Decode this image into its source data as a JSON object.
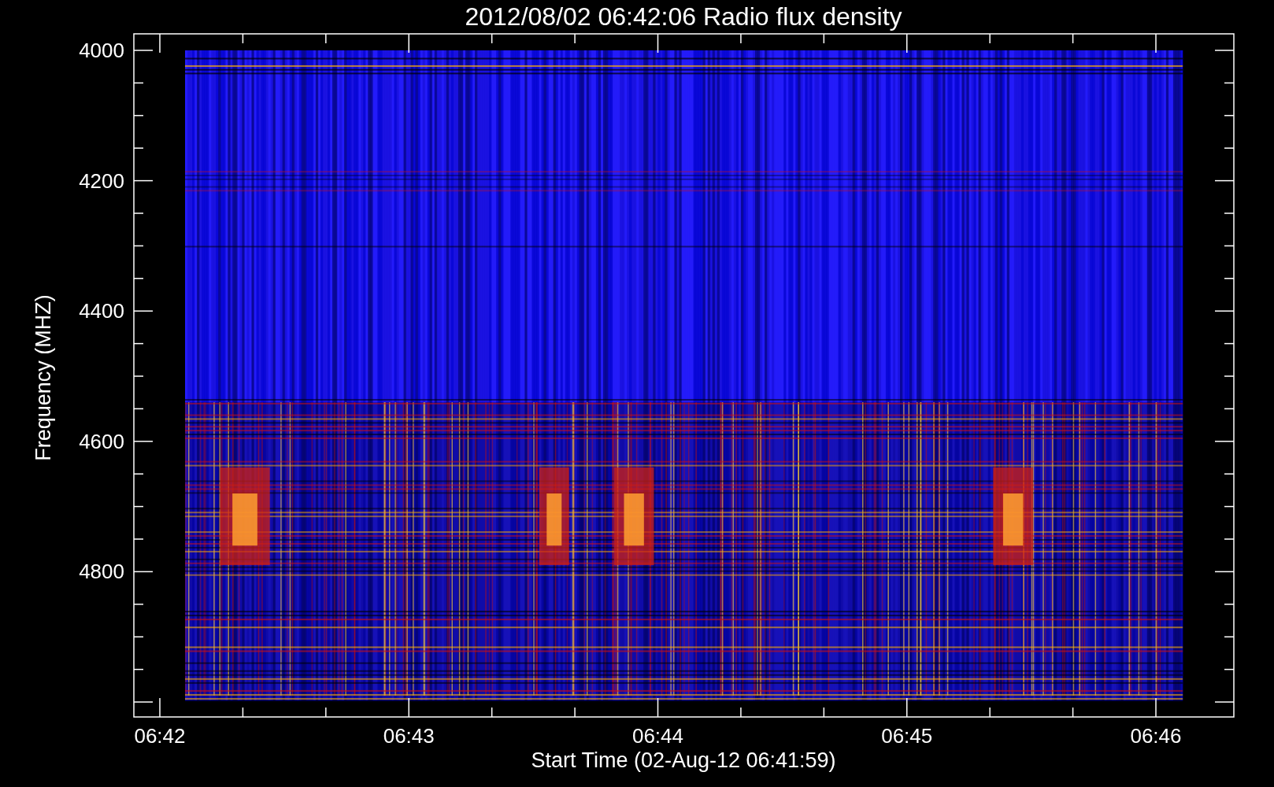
{
  "chart": {
    "title": "2012/08/02 06:42:06 Radio flux density",
    "x_axis": {
      "label": "Start Time (02-Aug-12 06:41:59)",
      "ticks": [
        "06:42",
        "06:43",
        "06:44",
        "06:45",
        "06:46"
      ]
    },
    "y_axis": {
      "label": "Frequency (MHZ)",
      "ticks": [
        "4000",
        "4200",
        "4400",
        "4600",
        "4800"
      ]
    }
  }
}
